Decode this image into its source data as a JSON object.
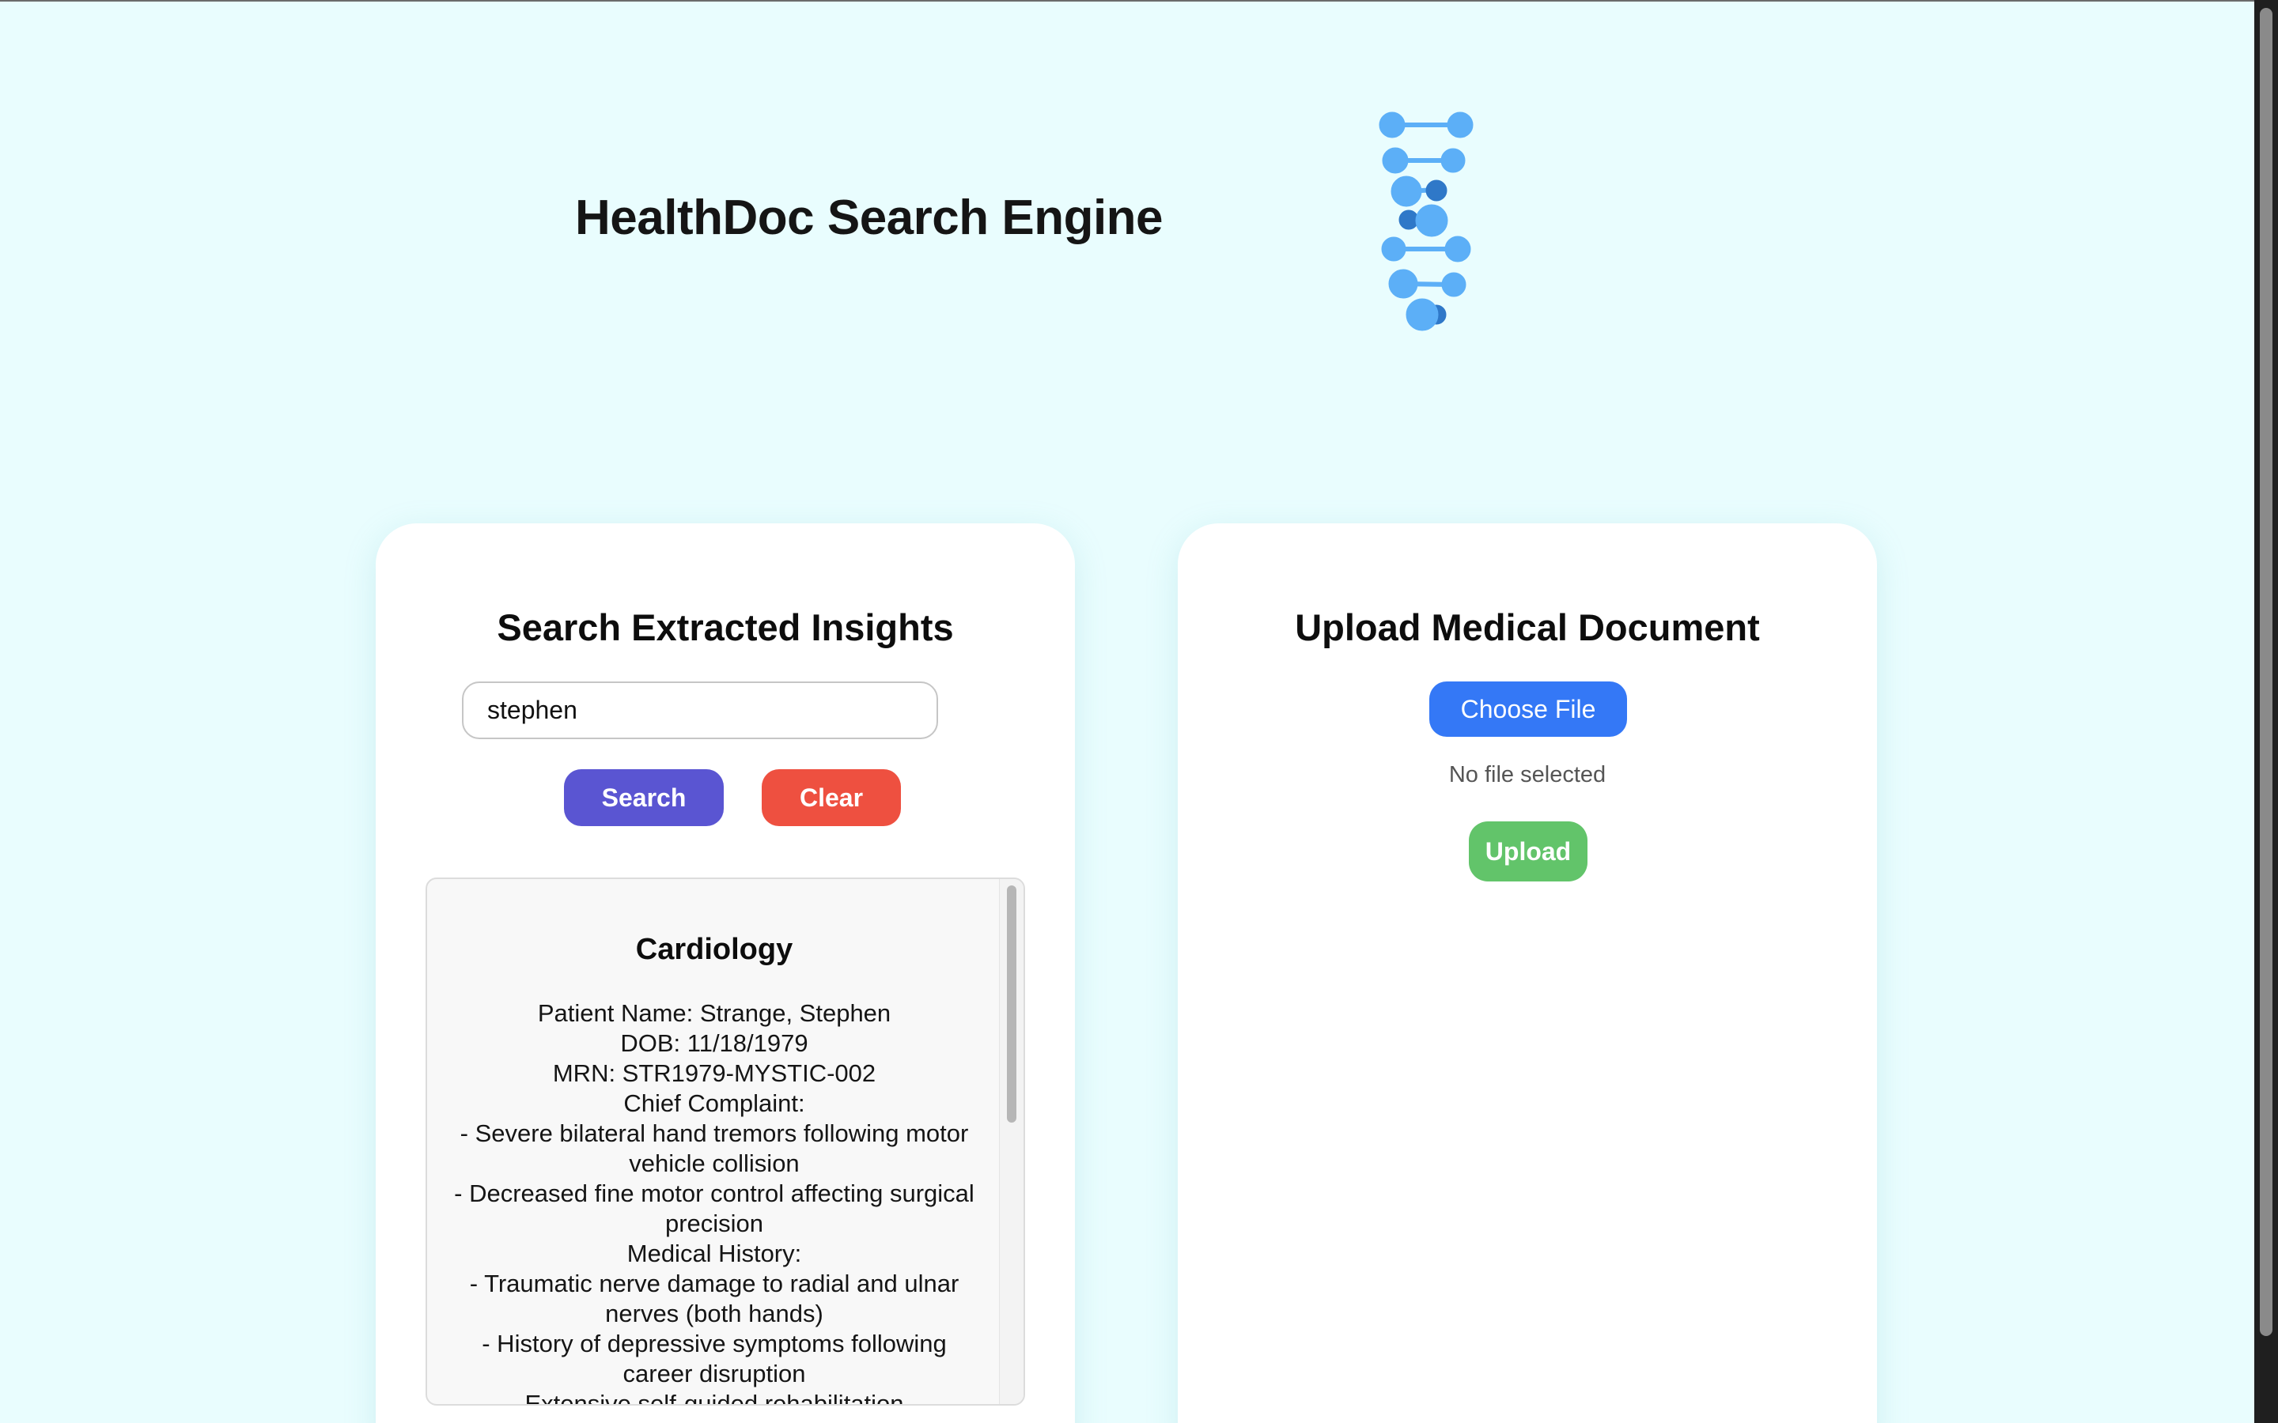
{
  "header": {
    "title": "HealthDoc Search Engine",
    "logo_icon": "dna-icon",
    "logo_color": "#5caff7"
  },
  "search_panel": {
    "title": "Search Extracted Insights",
    "input_value": "stephen",
    "search_label": "Search",
    "clear_label": "Clear",
    "result": {
      "heading": "Cardiology",
      "lines": [
        "Patient Name: Strange, Stephen",
        "DOB: 11/18/1979",
        "MRN: STR1979-MYSTIC-002",
        "Chief Complaint:",
        "- Severe bilateral hand tremors following motor vehicle collision",
        "- Decreased fine motor control affecting surgical precision",
        "Medical History:",
        "- Traumatic nerve damage to radial and ulnar nerves (both hands)",
        "- History of depressive symptoms following career disruption",
        "Extensive self-guided rehabilitation"
      ]
    }
  },
  "upload_panel": {
    "title": "Upload Medical Document",
    "choose_file_label": "Choose File",
    "file_status": "No file selected",
    "upload_label": "Upload"
  },
  "colors": {
    "background": "#e9fdfe",
    "search_button": "#5a55d2",
    "clear_button": "#ee5040",
    "choose_file_button": "#3478f6",
    "upload_button": "#62c46a"
  }
}
